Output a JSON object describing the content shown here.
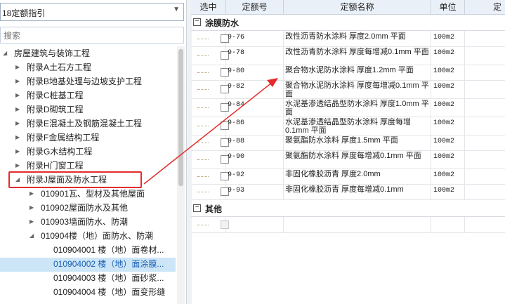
{
  "left": {
    "dropdown_value": "18定额指引",
    "search_placeholder": "搜索",
    "tree": [
      {
        "label": "房屋建筑与装饰工程",
        "level": 0,
        "state": "open"
      },
      {
        "label": "附录A土石方工程",
        "level": 1,
        "state": "closed"
      },
      {
        "label": "附录B地基处理与边坡支护工程",
        "level": 1,
        "state": "closed"
      },
      {
        "label": "附录C桩基工程",
        "level": 1,
        "state": "closed"
      },
      {
        "label": "附录D砌筑工程",
        "level": 1,
        "state": "closed"
      },
      {
        "label": "附录E混凝土及钢筋混凝土工程",
        "level": 1,
        "state": "closed"
      },
      {
        "label": "附录F金属结构工程",
        "level": 1,
        "state": "closed"
      },
      {
        "label": "附录G木结构工程",
        "level": 1,
        "state": "closed"
      },
      {
        "label": "附录H门窗工程",
        "level": 1,
        "state": "closed"
      },
      {
        "label": "附录J屋面及防水工程",
        "level": 1,
        "state": "open"
      },
      {
        "label": "010901瓦、型材及其他屋面",
        "level": 2,
        "state": "closed"
      },
      {
        "label": "010902屋面防水及其他",
        "level": 2,
        "state": "closed"
      },
      {
        "label": "010903墙面防水、防潮",
        "level": 2,
        "state": "closed"
      },
      {
        "label": "010904楼（地）面防水、防潮",
        "level": 2,
        "state": "open"
      },
      {
        "label": "010904001  楼（地）面卷材...",
        "level": 3,
        "state": "leaf"
      },
      {
        "label": "010904002  楼（地）面涂膜...",
        "level": 3,
        "state": "leaf",
        "selected": true
      },
      {
        "label": "010904003  楼（地）面砂浆...",
        "level": 3,
        "state": "leaf"
      },
      {
        "label": "010904004  楼（地）面变形缝",
        "level": 3,
        "state": "leaf"
      }
    ]
  },
  "table": {
    "headers": [
      "选中",
      "定额号",
      "定额名称",
      "单位",
      "定"
    ],
    "group1": "涂膜防水",
    "rows": [
      {
        "code": "9-76",
        "name": "改性沥青防水涂料 厚度2.0mm 平面",
        "unit": "100m2"
      },
      {
        "code": "9-78",
        "name": "改性沥青防水涂料 厚度每增减0.1mm 平面",
        "unit": "100m2"
      },
      {
        "code": "9-80",
        "name": "聚合物水泥防水涂料 厚度1.2mm 平面",
        "unit": "100m2"
      },
      {
        "code": "9-82",
        "name": "聚合物水泥防水涂料 厚度每增减0.1mm 平面",
        "unit": "100m2"
      },
      {
        "code": "9-84",
        "name": "水泥基渗透结晶型防水涂料 厚度1.0mm 平面",
        "unit": "100m2"
      },
      {
        "code": "9-86",
        "name": "水泥基渗透结晶型防水涂料 厚度每增 0.1mm 平面",
        "unit": "100m2"
      },
      {
        "code": "9-88",
        "name": "聚氨酯防水涂料 厚度1.5mm 平面",
        "unit": "100m2"
      },
      {
        "code": "9-90",
        "name": "聚氨酯防水涂料 厚度每增减0.1mm 平面",
        "unit": "100m2"
      },
      {
        "code": "9-92",
        "name": "非固化橡胶沥青 厚度2.0mm",
        "unit": "100m2"
      },
      {
        "code": "9-93",
        "name": "非固化橡胶沥青 厚度每增减0.1mm",
        "unit": "100m2"
      }
    ],
    "group2": "其他"
  },
  "colors": {
    "highlight": "#e52b2b",
    "selected_row": "#cde6f7",
    "selected_text": "#1a5fb4"
  }
}
